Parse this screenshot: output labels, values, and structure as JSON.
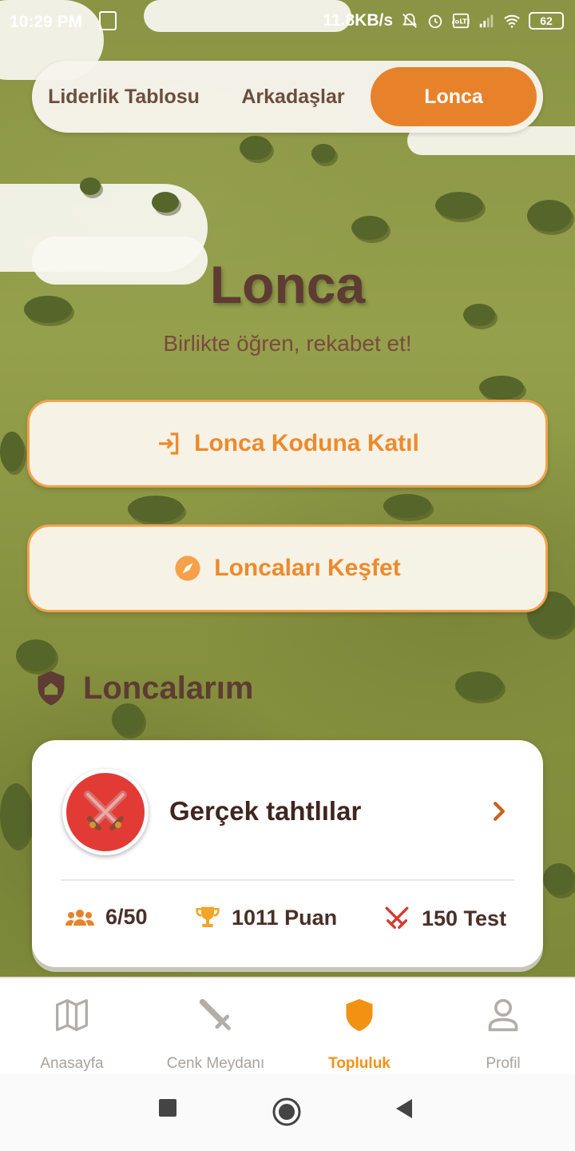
{
  "status_bar": {
    "time": "10:29 PM",
    "network_speed": "11.8KB/s",
    "battery": "62"
  },
  "top_tabs": {
    "items": [
      {
        "label": "Liderlik Tablosu",
        "active": false
      },
      {
        "label": "Arkadaşlar",
        "active": false
      },
      {
        "label": "Lonca",
        "active": true
      }
    ]
  },
  "hero": {
    "title": "Lonca",
    "subtitle": "Birlikte öğren, rekabet et!"
  },
  "actions": {
    "join_label": "Lonca Koduna Katıl",
    "join_icon": "login-icon",
    "explore_label": "Loncaları Keşfet",
    "explore_icon": "compass-icon"
  },
  "my_guilds": {
    "heading": "Loncalarım",
    "heading_icon": "house-shield-icon",
    "guilds": [
      {
        "name": "Gerçek tahtlılar",
        "avatar_icon": "crossed-swords-icon",
        "avatar_color": "#e23b36",
        "members": "6/50",
        "points": "1011 Puan",
        "tests": "150 Test"
      }
    ]
  },
  "bottom_nav": {
    "items": [
      {
        "label": "Anasayfa",
        "icon": "map-icon",
        "active": false
      },
      {
        "label": "Cenk Meydanı",
        "icon": "sword-icon",
        "active": false
      },
      {
        "label": "Topluluk",
        "icon": "shield-icon",
        "active": true
      },
      {
        "label": "Profil",
        "icon": "person-icon",
        "active": false
      }
    ]
  },
  "colors": {
    "accent": "#e8822a",
    "heading_brown": "#5e3b33",
    "nav_active": "#f29213"
  }
}
